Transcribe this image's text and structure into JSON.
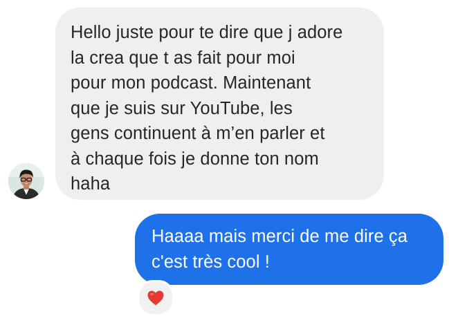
{
  "conversation": {
    "incoming_message": {
      "text": "Hello juste pour te dire que j adore\nla crea que t as fait pour moi\npour mon podcast. Maintenant\nque je suis sur YouTube, les\ngens continuent à m’en parler et\nà chaque fois je donne ton nom\nhaha",
      "bubble_color": "#efefef",
      "text_color": "#262626"
    },
    "outgoing_message": {
      "text": "Haaaa mais merci de me dire ça\nc'est très cool !",
      "bubble_color": "#1f71ea",
      "text_color": "#ffffff"
    },
    "reaction": {
      "icon": "red-heart-icon",
      "color": "#e53935"
    },
    "sender_avatar": {
      "icon": "profile-photo-avatar"
    }
  }
}
